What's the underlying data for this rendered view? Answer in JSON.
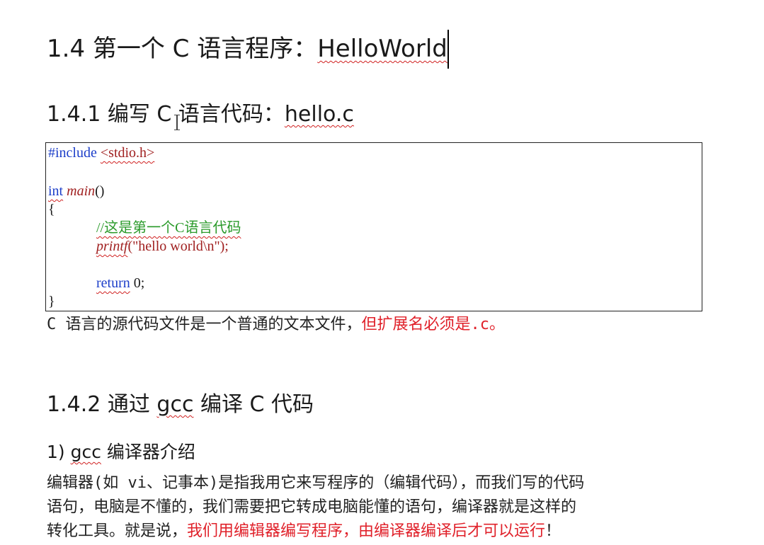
{
  "heading_1": {
    "prefix": "1.4 第一个 C 语言程序：",
    "word": "HelloWorld"
  },
  "heading_2": {
    "prefix": "1.4.1 编写 C 语言代码：",
    "word": "hello.c"
  },
  "code": {
    "include": {
      "directive": "#include",
      "header": "<stdio.h>"
    },
    "signature": {
      "type": "int",
      "name": "main",
      "parens": "()"
    },
    "open_brace": "{",
    "comment": "//这是第一个C语言代码",
    "printf": {
      "name": "printf",
      "args": "(\"hello world\\n\");"
    },
    "return": {
      "keyword": "return",
      "value": " 0;"
    },
    "close_brace": "}"
  },
  "note": {
    "text": "C 语言的源代码文件是一个普通的文本文件，",
    "highlight": "但扩展名必须是.c。"
  },
  "heading_3": {
    "prefix": "1.4.2 通过 ",
    "word": "gcc",
    "suffix": " 编译 C 代码"
  },
  "heading_4": {
    "prefix": "1) ",
    "word": "gcc",
    "suffix": " 编译器介绍"
  },
  "paragraph": {
    "line1": "编辑器(如 vi、记事本)是指我用它来写程序的（编辑代码），而我们写的代码",
    "line2": "语句，电脑是不懂的，我们需要把它转成电脑能懂的语句，编译器就是这样的",
    "line3_prefix": "转化工具。就是说，",
    "line3_highlight": "我们用编辑器编写程序，由编译器编译后才可以运行",
    "line3_suffix": "！"
  },
  "colors": {
    "keyword": "#1c3ec9",
    "function": "#a02020",
    "comment": "#2a9a2a",
    "highlight": "#e0212a"
  }
}
